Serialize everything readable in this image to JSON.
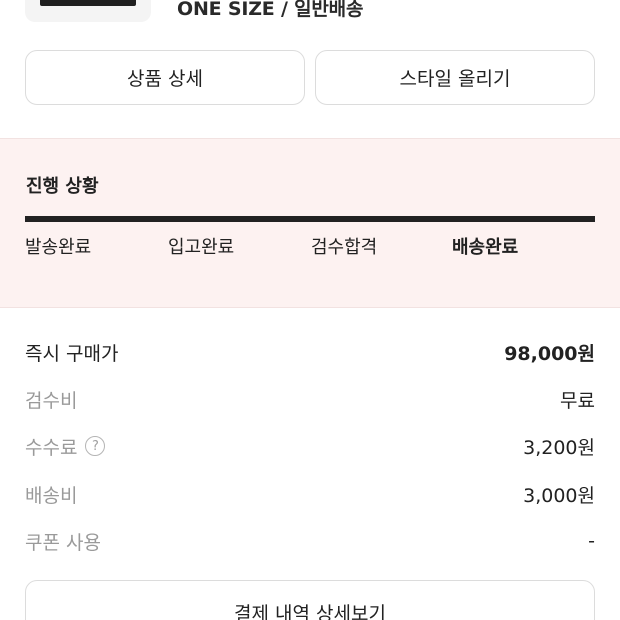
{
  "product": {
    "option_text": "ONE SIZE / 일반배송"
  },
  "actions": {
    "detail_label": "상품 상세",
    "style_label": "스타일 올리기"
  },
  "progress": {
    "title": "진행 상황",
    "fill_fraction": 1.0,
    "steps": [
      {
        "label": "발송완료"
      },
      {
        "label": "입고완료"
      },
      {
        "label": "검수합격"
      },
      {
        "label": "배송완료"
      }
    ],
    "current_step": "배송완료"
  },
  "payment": {
    "rows": [
      {
        "label": "즉시 구매가",
        "value": "98,000원"
      },
      {
        "label": "검수비",
        "value": "무료"
      },
      {
        "label": "수수료",
        "value": "3,200원"
      },
      {
        "label": "배송비",
        "value": "3,000원"
      },
      {
        "label": "쿠폰 사용",
        "value": "-"
      }
    ],
    "detail_button_label": "결제 내역 상세보기"
  },
  "icons": {
    "help": "question-circle-icon"
  },
  "colors": {
    "progress_bg": "#fdf2f1",
    "progress_fill": "#222222",
    "muted_text": "#9a9a9a"
  }
}
